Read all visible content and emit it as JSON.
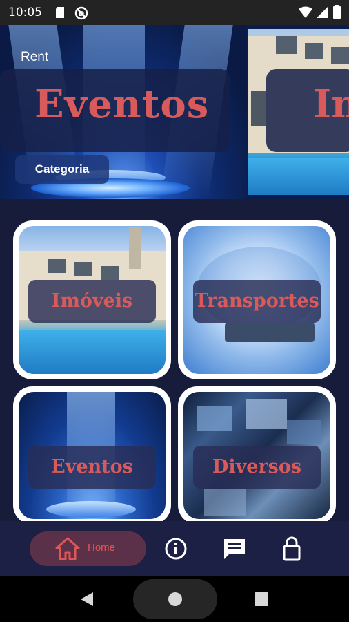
{
  "status_bar": {
    "time": "10:05",
    "icons": [
      "sd-card-icon",
      "do-not-disturb-icon",
      "wifi-icon",
      "signal-icon",
      "battery-icon"
    ]
  },
  "hero": {
    "rent_label": "Rent",
    "slides": [
      {
        "title": "Eventos",
        "category_label": "Categoria"
      },
      {
        "title": "Im"
      }
    ]
  },
  "categories": [
    {
      "title": "Imóveis"
    },
    {
      "title": "Transportes"
    },
    {
      "title": "Eventos"
    },
    {
      "title": "Diversos"
    }
  ],
  "bottom_nav": {
    "home_label": "Home",
    "items": [
      "home-icon",
      "info-icon",
      "chat-icon",
      "lock-icon"
    ]
  },
  "colors": {
    "background": "#161c3a",
    "accent_red": "#d95a5a",
    "home_pill": "#5a3148",
    "nav_bar": "#1b2044"
  }
}
